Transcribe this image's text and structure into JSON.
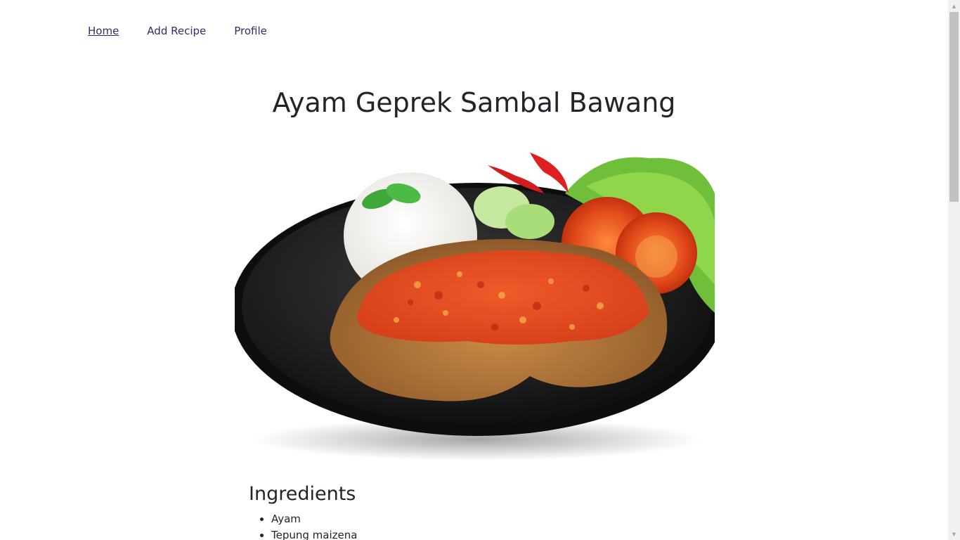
{
  "nav": {
    "home": "Home",
    "add_recipe": "Add Recipe",
    "profile": "Profile"
  },
  "recipe": {
    "title": "Ayam Geprek Sambal Bawang",
    "ingredients_heading": "Ingredients",
    "ingredients": [
      "Ayam",
      "Tepung maizena"
    ]
  },
  "colors": {
    "nav_link": "#2f2d6b",
    "text": "#212529",
    "scrollbar_track": "#f1f1f1",
    "scrollbar_thumb": "#c1c1c1"
  },
  "icons": {
    "scroll_up": "arrow-up-icon",
    "scroll_down": "arrow-down-icon"
  }
}
